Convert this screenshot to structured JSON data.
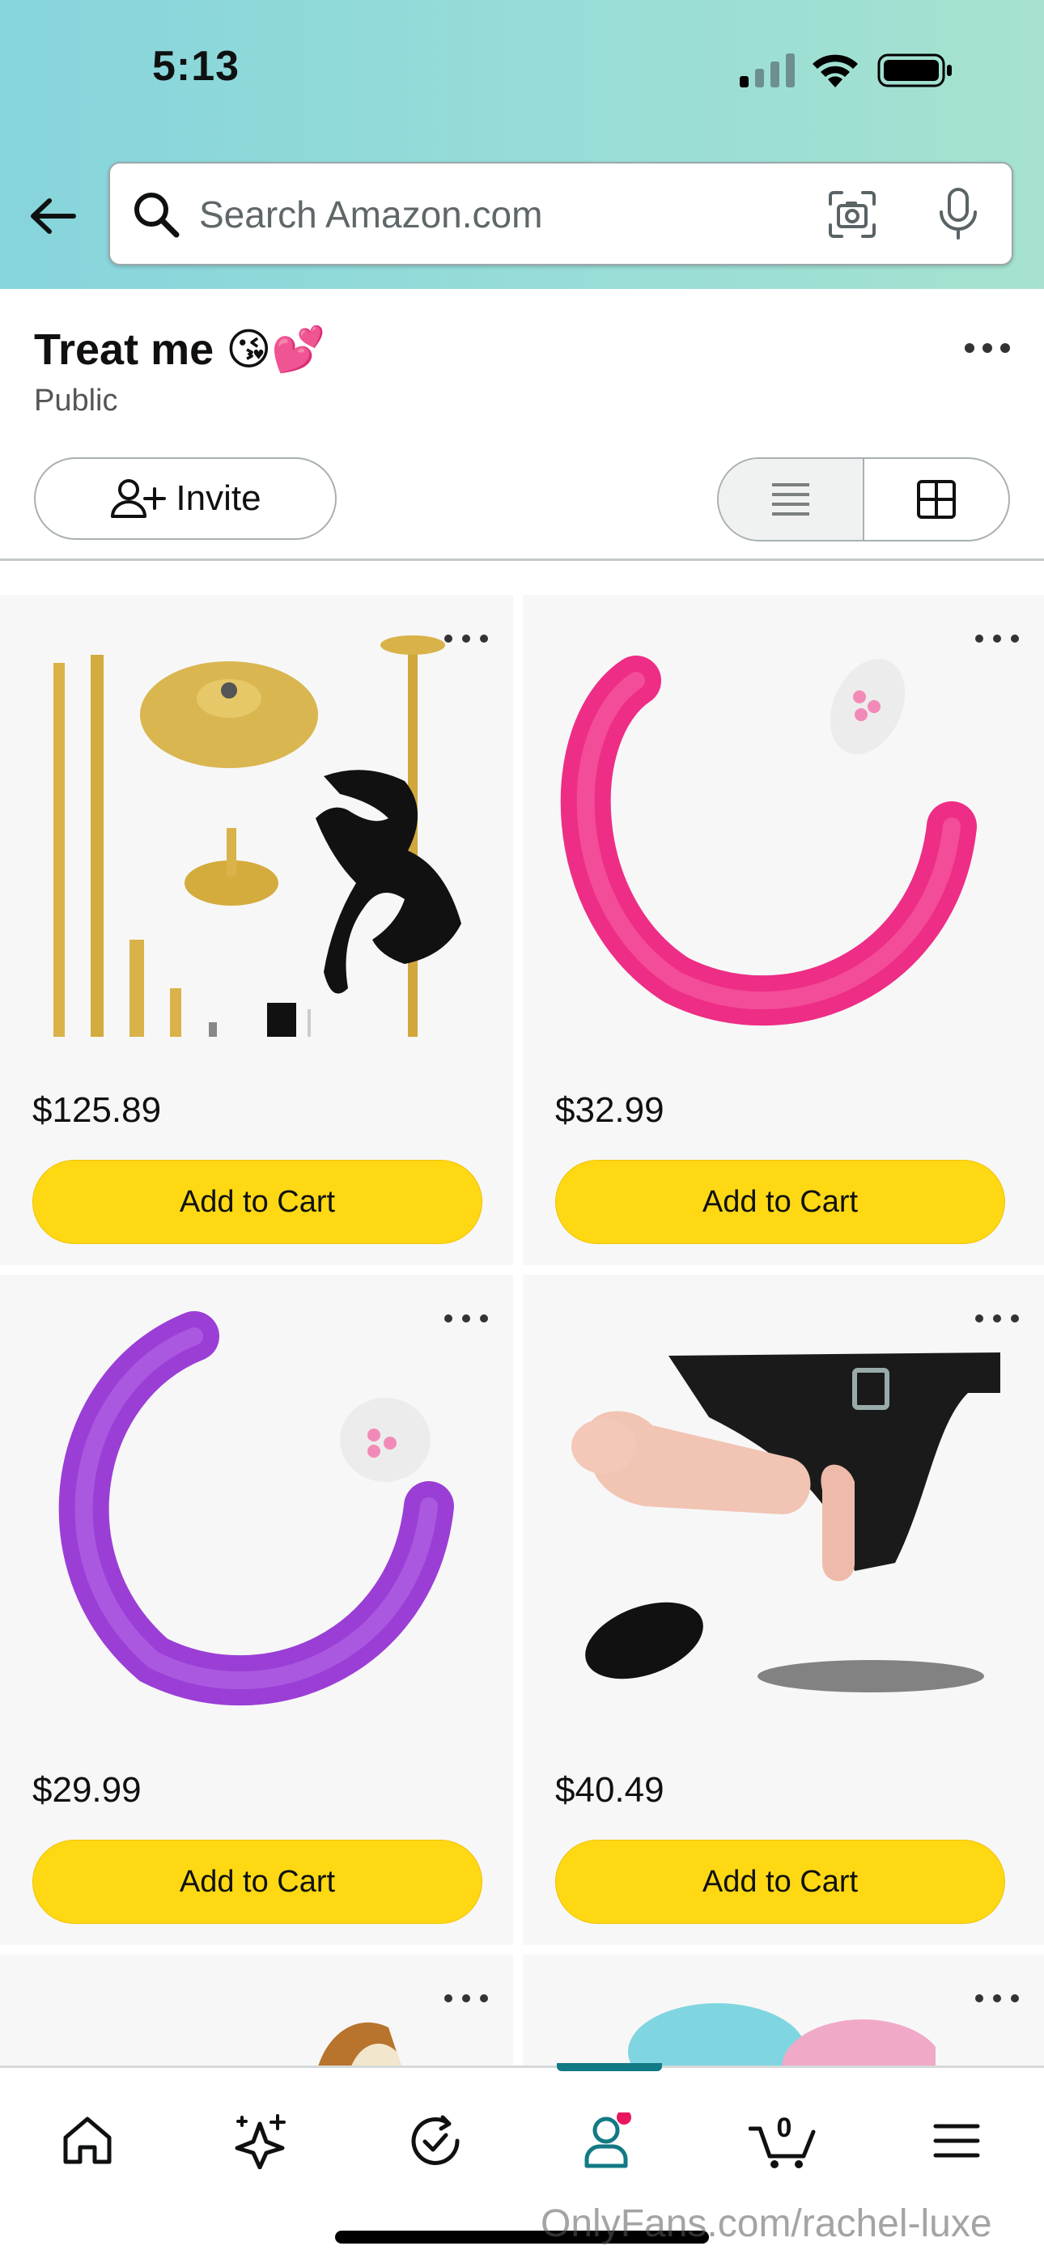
{
  "status_bar": {
    "time": "5:13"
  },
  "search": {
    "placeholder": "Search Amazon.com"
  },
  "list": {
    "title": "Treat me 😘💕",
    "visibility": "Public",
    "invite_label": "Invite"
  },
  "products": [
    {
      "price": "$125.89",
      "cta": "Add to Cart",
      "image": "dance-pole-kit"
    },
    {
      "price": "$32.99",
      "cta": "Add to Cart",
      "image": "pink-double-ended-toy"
    },
    {
      "price": "$29.99",
      "cta": "Add to Cart",
      "image": "purple-double-ended-toy"
    },
    {
      "price": "$40.49",
      "cta": "Add to Cart",
      "image": "strap-on-harness"
    }
  ],
  "cart": {
    "count": "0"
  },
  "nav": {
    "items": [
      "home-icon",
      "rufus-icon",
      "deals-icon",
      "account-icon",
      "cart-icon",
      "menu-icon"
    ],
    "active": "account-icon"
  },
  "watermark": "OnlyFans.com/rachel-luxe",
  "colors": {
    "header_gradient_start": "#86d4dc",
    "header_gradient_end": "#a6e2cf",
    "cart_button": "#ffd814",
    "active_nav": "#117a84",
    "notification_dot": "#e8175d"
  }
}
